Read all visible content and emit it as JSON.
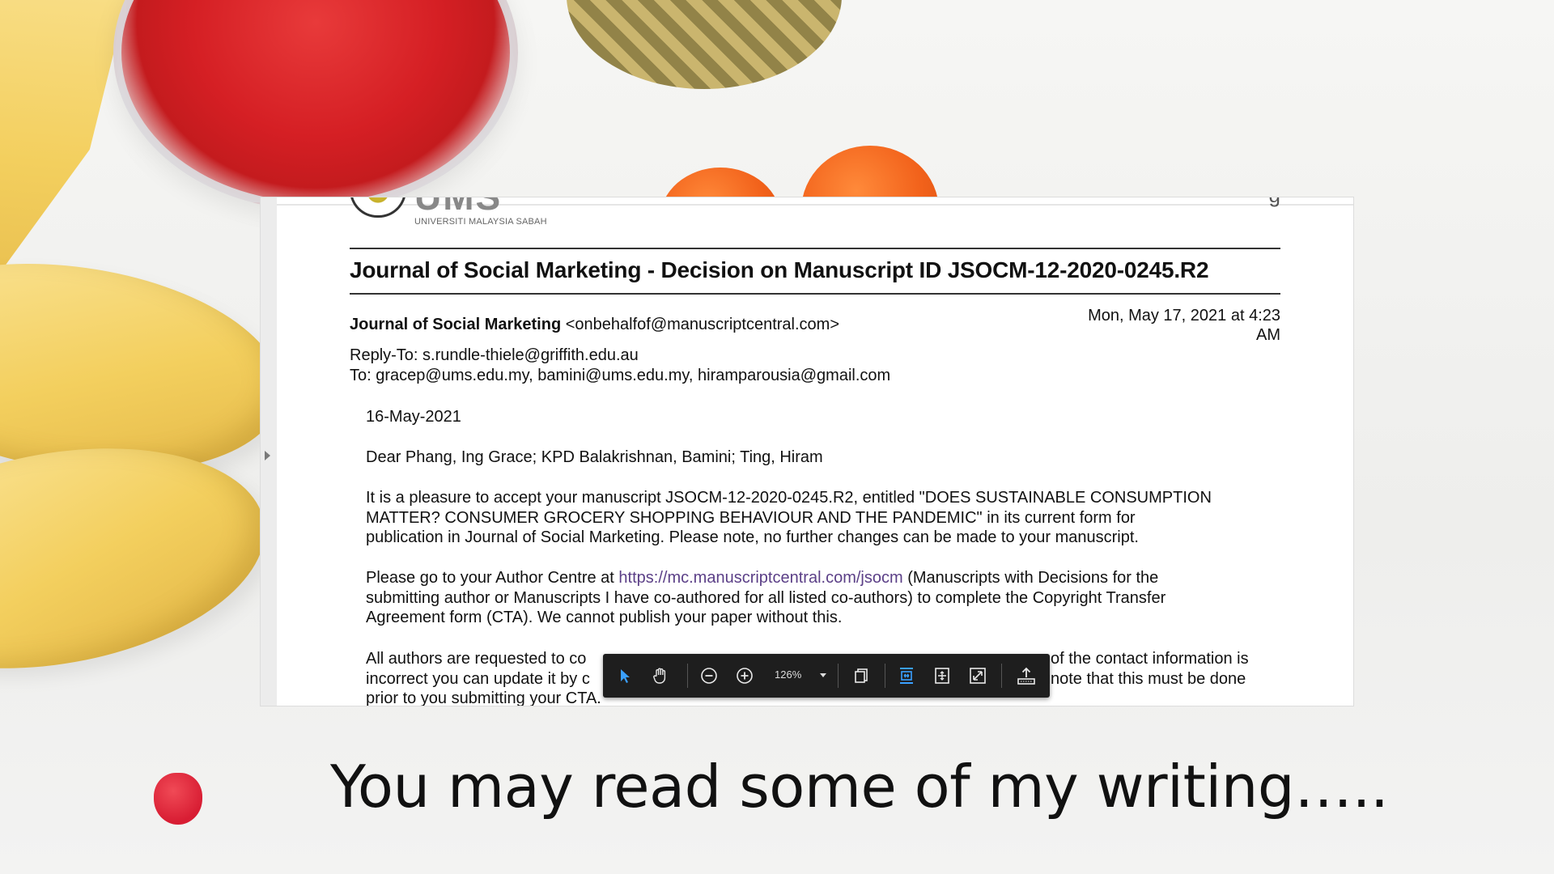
{
  "document": {
    "logo_text": "UMS",
    "logo_subtitle": "UNIVERSITI MALAYSIA SABAH",
    "corner_fragment": "g",
    "subject": "Journal of Social Marketing - Decision on Manuscript ID JSOCM-12-2020-0245.R2",
    "from_name": "Journal of Social Marketing",
    "from_email": "<onbehalfof@manuscriptcentral.com>",
    "date_line1": "Mon, May 17, 2021 at 4:23",
    "date_line2": "AM",
    "reply_to": "Reply-To: s.rundle-thiele@griffith.edu.au",
    "to": "To: gracep@ums.edu.my, bamini@ums.edu.my, hiramparousia@gmail.com",
    "letter_date": "16-May-2021",
    "salutation": "Dear Phang, Ing Grace; KPD Balakrishnan, Bamini; Ting, Hiram",
    "para1_line1": "It is a pleasure to accept your manuscript JSOCM-12-2020-0245.R2, entitled \"DOES SUSTAINABLE CONSUMPTION",
    "para1_line2": "MATTER? CONSUMER GROCERY SHOPPING BEHAVIOUR AND THE PANDEMIC\" in its current form for",
    "para1_line3": "publication in Journal of Social Marketing.   Please note, no further changes can be made to your manuscript.",
    "para2_pre": "Please go to your Author Centre at ",
    "para2_link": "https://mc.manuscriptcentral.com/jsocm",
    "para2_post": " (Manuscripts with Decisions for the",
    "para2_line2": "submitting author or Manuscripts I have co-authored for all listed co-authors) to complete the Copyright Transfer",
    "para2_line3": "Agreement form (CTA).  We cannot publish your paper without this.",
    "para3_line1_left": "All authors are requested to co",
    "para3_line1_right": "of the contact information is",
    "para3_line2_left": "incorrect you can update it by c",
    "para3_line2_right": "note that this must be done",
    "para3_line3": "prior to you submitting your CTA."
  },
  "toolbar": {
    "zoom_value": "126%",
    "icons": [
      "select-arrow-icon",
      "hand-tool-icon",
      "zoom-out-icon",
      "zoom-in-icon",
      "page-view-icon",
      "fit-width-icon",
      "fit-page-icon",
      "fullscreen-icon",
      "export-icon"
    ],
    "accent_color": "#3aa0ff"
  },
  "caption": "You may read some of my writing….."
}
